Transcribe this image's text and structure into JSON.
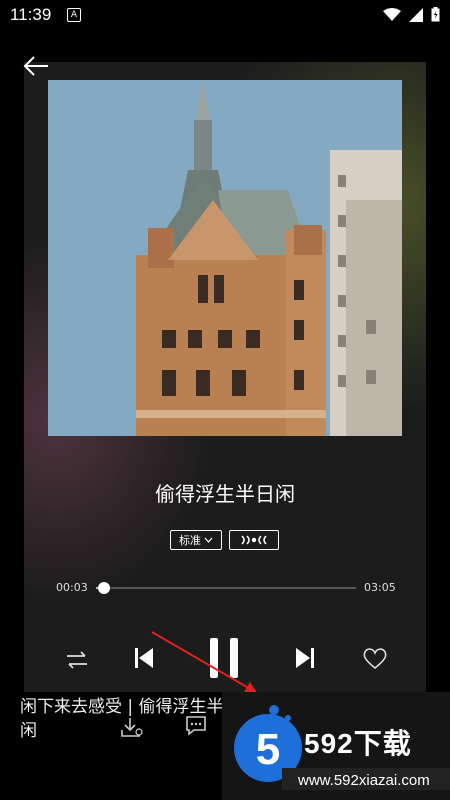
{
  "status_bar": {
    "time": "11:39",
    "app_icon": "A"
  },
  "header": {
    "back_icon": "arrow-left"
  },
  "song": {
    "title": "偷得浮生半日闲"
  },
  "quality": {
    "label": "标准",
    "effect_label": "·)))•((("
  },
  "progress": {
    "current": "00:03",
    "total": "03:05",
    "fraction": 0.03
  },
  "lyric": {
    "text": "闲下来去感受 | 偷得浮生半闲"
  },
  "watermark": {
    "brand": "592下载",
    "url": "www.592xiazai.com",
    "logo_digit": "5"
  },
  "colors": {
    "accent_red": "#e02020",
    "watermark_blue": "#1e6fd9"
  }
}
